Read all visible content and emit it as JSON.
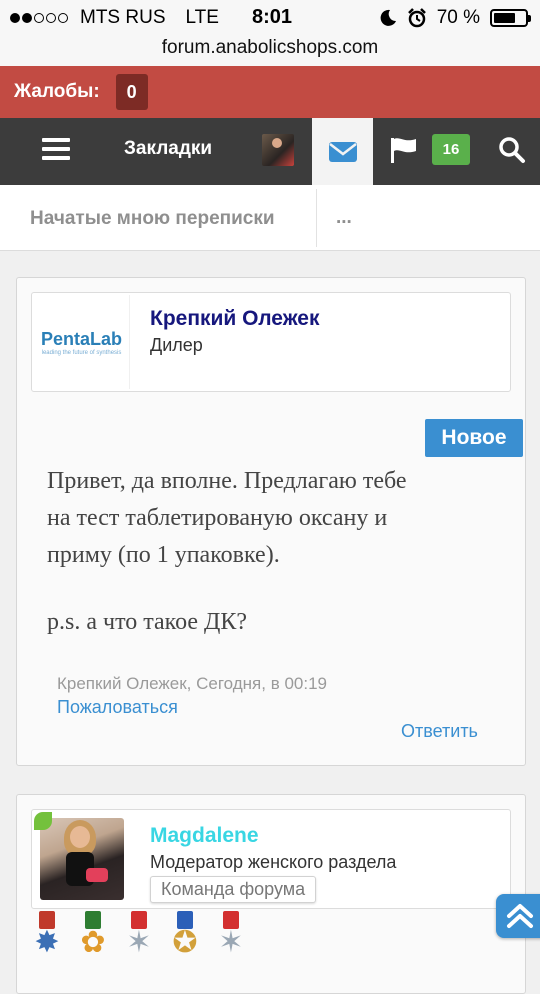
{
  "status_bar": {
    "carrier": "MTS RUS",
    "network": "LTE",
    "time": "8:01",
    "battery": "70 %",
    "battery_level": 0.7,
    "signal_bars": 2
  },
  "url": "forum.anabolicshops.com",
  "complaints": {
    "label": "Жалобы:",
    "count": "0"
  },
  "nav": {
    "bookmarks_label": "Закладки",
    "alerts_count": "16",
    "icons": [
      "menu-icon",
      "avatar",
      "mail-icon",
      "flag-icon",
      "search-icon"
    ]
  },
  "subnav": {
    "title": "Начатые мною переписки",
    "more": "..."
  },
  "messages": [
    {
      "username": "Крепкий Олежек",
      "user_title": "Дилер",
      "avatar_logo": "PentaLab",
      "avatar_tagline": "leading the future of synthesis",
      "badge": "Новое",
      "body_lines": [
        "Привет, да вполне. Предлагаю тебе",
        "на тест таблетированую оксану и",
        "приму (по 1 упаковке)."
      ],
      "ps": "p.s. а что такое ДК?",
      "meta": "Крепкий Олежек, Сегодня, в 00:19",
      "report_label": "Пожаловаться",
      "reply_label": "Ответить"
    },
    {
      "username": "Magdalene",
      "user_title": "Модератор женского раздела",
      "team_badge": "Команда форума",
      "online": true
    }
  ],
  "colors": {
    "complaints_bar": "#c24b43",
    "nav_bar": "#3c3c3c",
    "accent": "#3a8fd1",
    "alerts_badge": "#5ab04b",
    "dealer_name": "#16177d",
    "moderator_name": "#39d6e3"
  }
}
